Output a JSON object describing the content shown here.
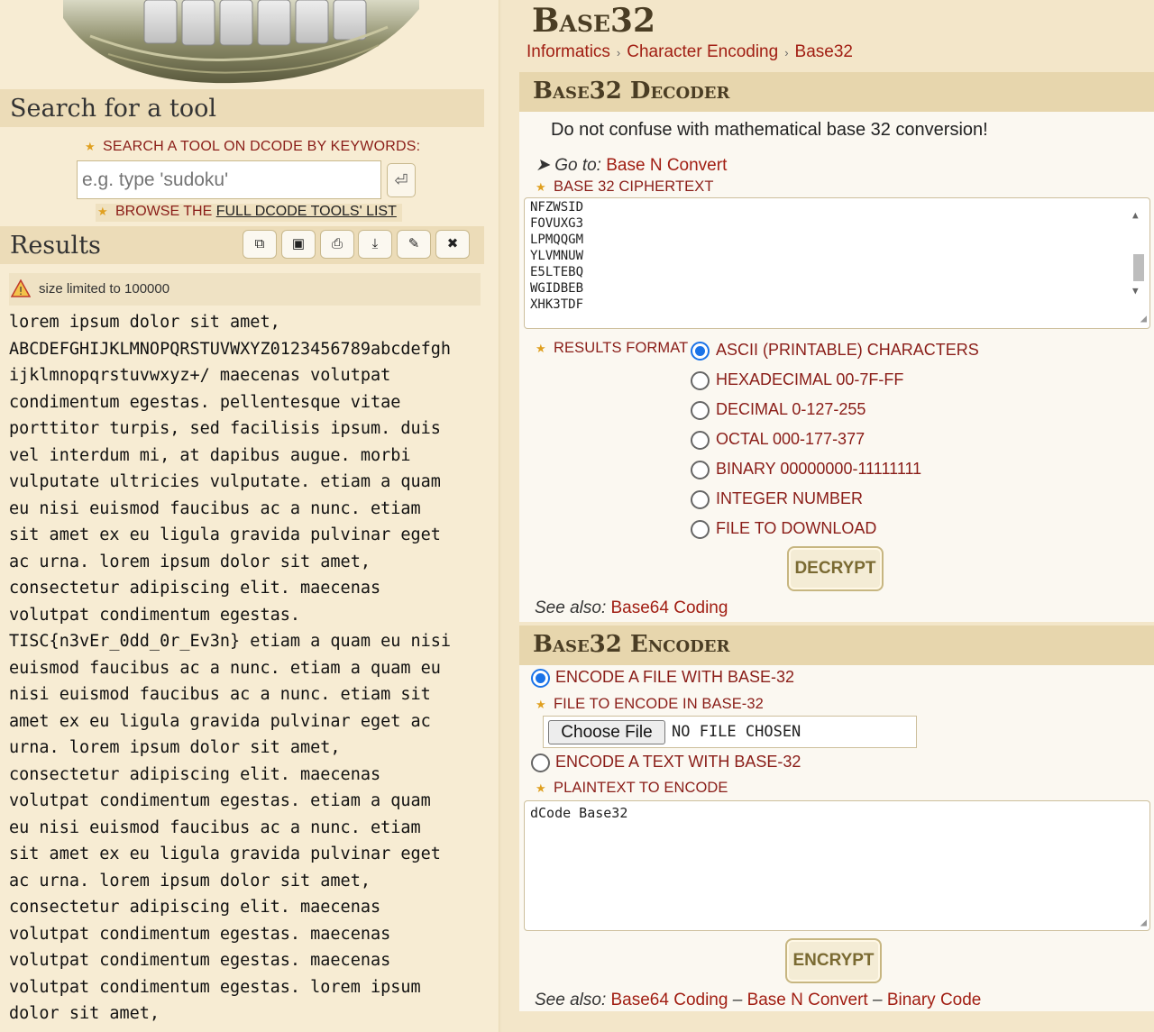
{
  "sidebar": {
    "search_title": "Search for a tool",
    "keywords_label": "SEARCH A TOOL ON DCODE BY KEYWORDS:",
    "search_placeholder": "e.g. type 'sudoku'",
    "search_button_icon": "enter-icon",
    "browse_prefix": "BROWSE THE ",
    "browse_link": "FULL DCODE TOOLS' LIST",
    "results_title": "Results",
    "toolbar_icons": [
      "copy-icon",
      "save-icon",
      "print-icon",
      "download-icon",
      "pin-icon",
      "close-icon"
    ],
    "warning": "size limited to 100000",
    "results_lines": [
      "lorem ipsum dolor sit amet,",
      "ABCDEFGHIJKLMNOPQRSTUVWXYZ0123456789abcdefgh",
      "ijklmnopqrstuvwxyz+/ maecenas volutpat",
      "condimentum egestas. pellentesque vitae",
      "porttitor turpis, sed facilisis ipsum. duis",
      "vel interdum mi, at dapibus augue. morbi",
      "vulputate ultricies vulputate. etiam a quam",
      "eu nisi euismod faucibus ac a nunc. etiam",
      "sit amet ex eu ligula gravida pulvinar eget",
      "ac urna. lorem ipsum dolor sit amet,",
      "consectetur adipiscing elit. maecenas",
      "volutpat condimentum egestas.",
      "TISC{n3vEr_0dd_0r_Ev3n} etiam a quam eu nisi",
      "euismod faucibus ac a nunc. etiam a quam eu",
      "nisi euismod faucibus ac a nunc. etiam sit",
      "amet ex eu ligula gravida pulvinar eget ac",
      "urna. lorem ipsum dolor sit amet,",
      "consectetur adipiscing elit. maecenas",
      "volutpat condimentum egestas. etiam a quam",
      "eu nisi euismod faucibus ac a nunc. etiam",
      "sit amet ex eu ligula gravida pulvinar eget",
      "ac urna. lorem ipsum dolor sit amet,",
      "consectetur adipiscing elit. maecenas",
      "volutpat condimentum egestas. maecenas",
      "volutpat condimentum egestas. maecenas",
      "volutpat condimentum egestas. lorem ipsum",
      "dolor sit amet,"
    ]
  },
  "page": {
    "title": "Base32",
    "breadcrumb": [
      "Informatics",
      "Character Encoding",
      "Base32"
    ]
  },
  "decoder": {
    "heading": "Base32 Decoder",
    "note": "Do not confuse with mathematical base 32 conversion!",
    "goto_prefix": "Go to: ",
    "goto_link": "Base N Convert",
    "cipher_label": "BASE 32 CIPHERTEXT",
    "cipher_lines": [
      "NFZWSID",
      "FOVUXG3",
      "LPMQQGM",
      "YLVMNUW",
      "E5LTEBQ",
      "WGIDBEB",
      "XHK3TDF"
    ],
    "format_label": "RESULTS FORMAT",
    "formats": [
      "ASCII (PRINTABLE) CHARACTERS",
      "HEXADECIMAL 00-7F-FF",
      "DECIMAL 0-127-255",
      "OCTAL 000-177-377",
      "BINARY 00000000-11111111",
      "INTEGER NUMBER",
      "FILE TO DOWNLOAD"
    ],
    "selected_format": "ASCII (PRINTABLE) CHARACTERS",
    "button": "DECRYPT",
    "see_also_prefix": "See also: ",
    "see_also_link": "Base64 Coding"
  },
  "encoder": {
    "heading": "Base32 Encoder",
    "option_file": "ENCODE A FILE WITH BASE-32",
    "file_label": "FILE TO ENCODE IN BASE-32",
    "choose_file": "Choose File",
    "no_file": "NO FILE CHOSEN",
    "option_text": "ENCODE A TEXT WITH BASE-32",
    "plaintext_label": "PLAINTEXT TO ENCODE",
    "plaintext_value": "dCode Base32",
    "button": "ENCRYPT",
    "see_also_prefix": "See also: ",
    "see_also_links": [
      "Base64 Coding",
      "Base N Convert",
      "Binary Code"
    ],
    "see_also_sep": " – "
  },
  "colors": {
    "accent_red": "#a11e13",
    "page_bg": "#f7ecd3",
    "radio_blue": "#1a73e8"
  }
}
